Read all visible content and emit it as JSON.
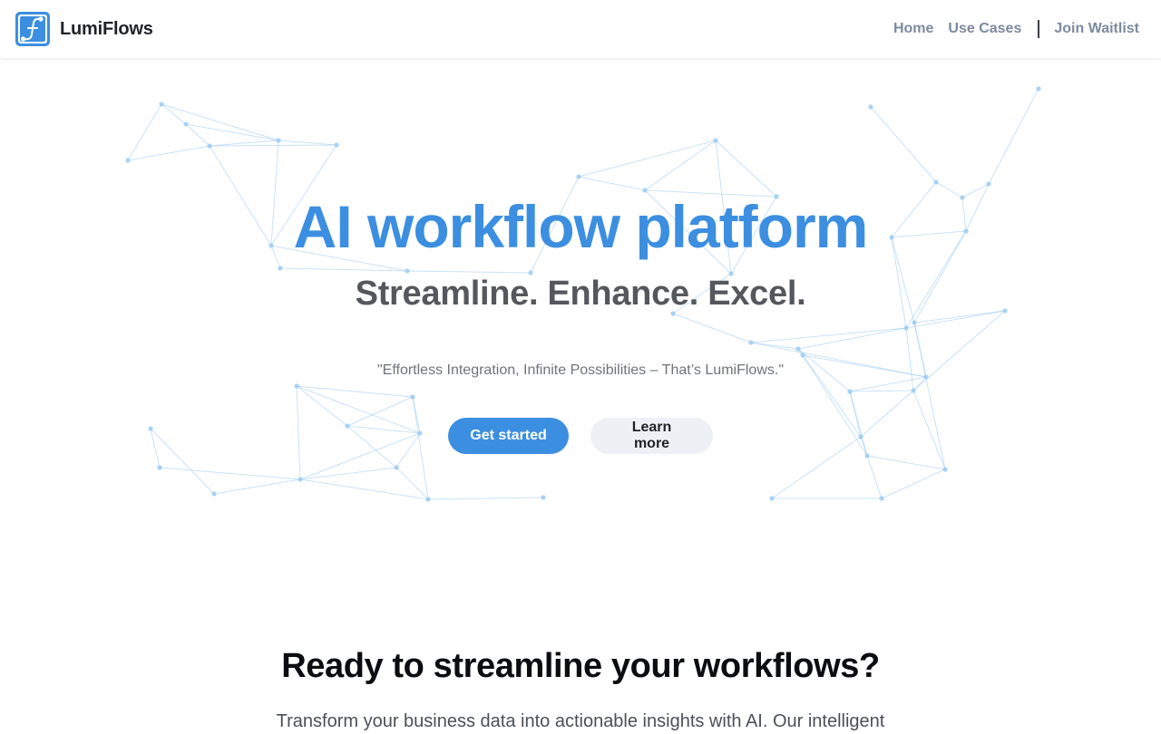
{
  "header": {
    "brand_name": "LumiFlows",
    "logo_icon": "lumiflows-logo-icon",
    "nav": [
      {
        "label": "Home"
      },
      {
        "label": "Use Cases"
      },
      {
        "label": "Join Waitlist"
      }
    ]
  },
  "hero": {
    "title": "AI workflow platform",
    "subtitle": "Streamline. Enhance. Excel.",
    "tagline": "\"Effortless Integration, Infinite Possibilities – That’s LumiFlows.\"",
    "primary_button": "Get started",
    "secondary_button": "Learn more",
    "background_graphic": "network-graph-illustration"
  },
  "cta": {
    "title": "Ready to streamline your workflows?",
    "body": "Transform your business data into actionable insights with AI. Our intelligent"
  },
  "colors": {
    "accent": "#3c8fe0",
    "network": "#9ccbf2",
    "nav_text": "#7c8aa0"
  }
}
